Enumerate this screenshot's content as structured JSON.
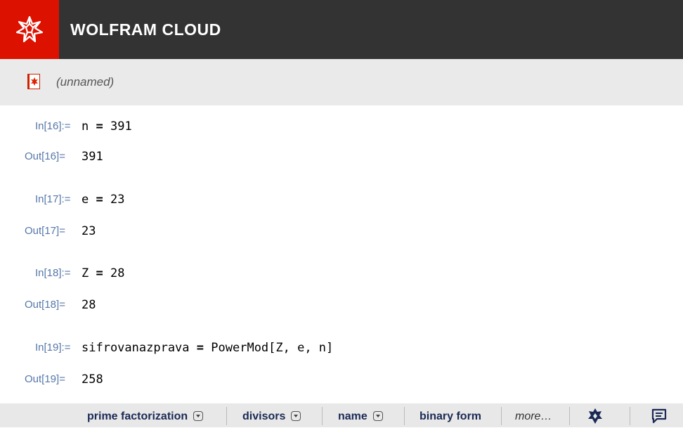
{
  "header": {
    "brand": "WOLFRAM CLOUD",
    "logo_icon": "wolfram-spikey-icon",
    "brand_color": "#dd1100",
    "bar_color": "#333333"
  },
  "notebook": {
    "title": "(unnamed)",
    "icon": "notebook-icon"
  },
  "cells": [
    {
      "in_label": "In[16]:=",
      "in_code": {
        "lhs": "n",
        "op": "=",
        "rhs": "391"
      },
      "out_label": "Out[16]=",
      "out_value": "391"
    },
    {
      "in_label": "In[17]:=",
      "in_code": {
        "lhs": "e",
        "op": "=",
        "rhs": "23"
      },
      "out_label": "Out[17]=",
      "out_value": "23"
    },
    {
      "in_label": "In[18]:=",
      "in_code": {
        "lhs": "Z",
        "op": "=",
        "rhs": "28"
      },
      "out_label": "Out[18]=",
      "out_value": "28"
    },
    {
      "in_label": "In[19]:=",
      "in_code": {
        "lhs": "sifrovanazprava",
        "op": "=",
        "rhs": "PowerMod[Z, e, n]"
      },
      "out_label": "Out[19]=",
      "out_value": "258"
    }
  ],
  "suggestions": {
    "items": [
      "prime factorization",
      "divisors",
      "name",
      "binary form"
    ],
    "more": "more…",
    "icons": [
      "spikey-settings-icon",
      "feedback-icon"
    ]
  }
}
